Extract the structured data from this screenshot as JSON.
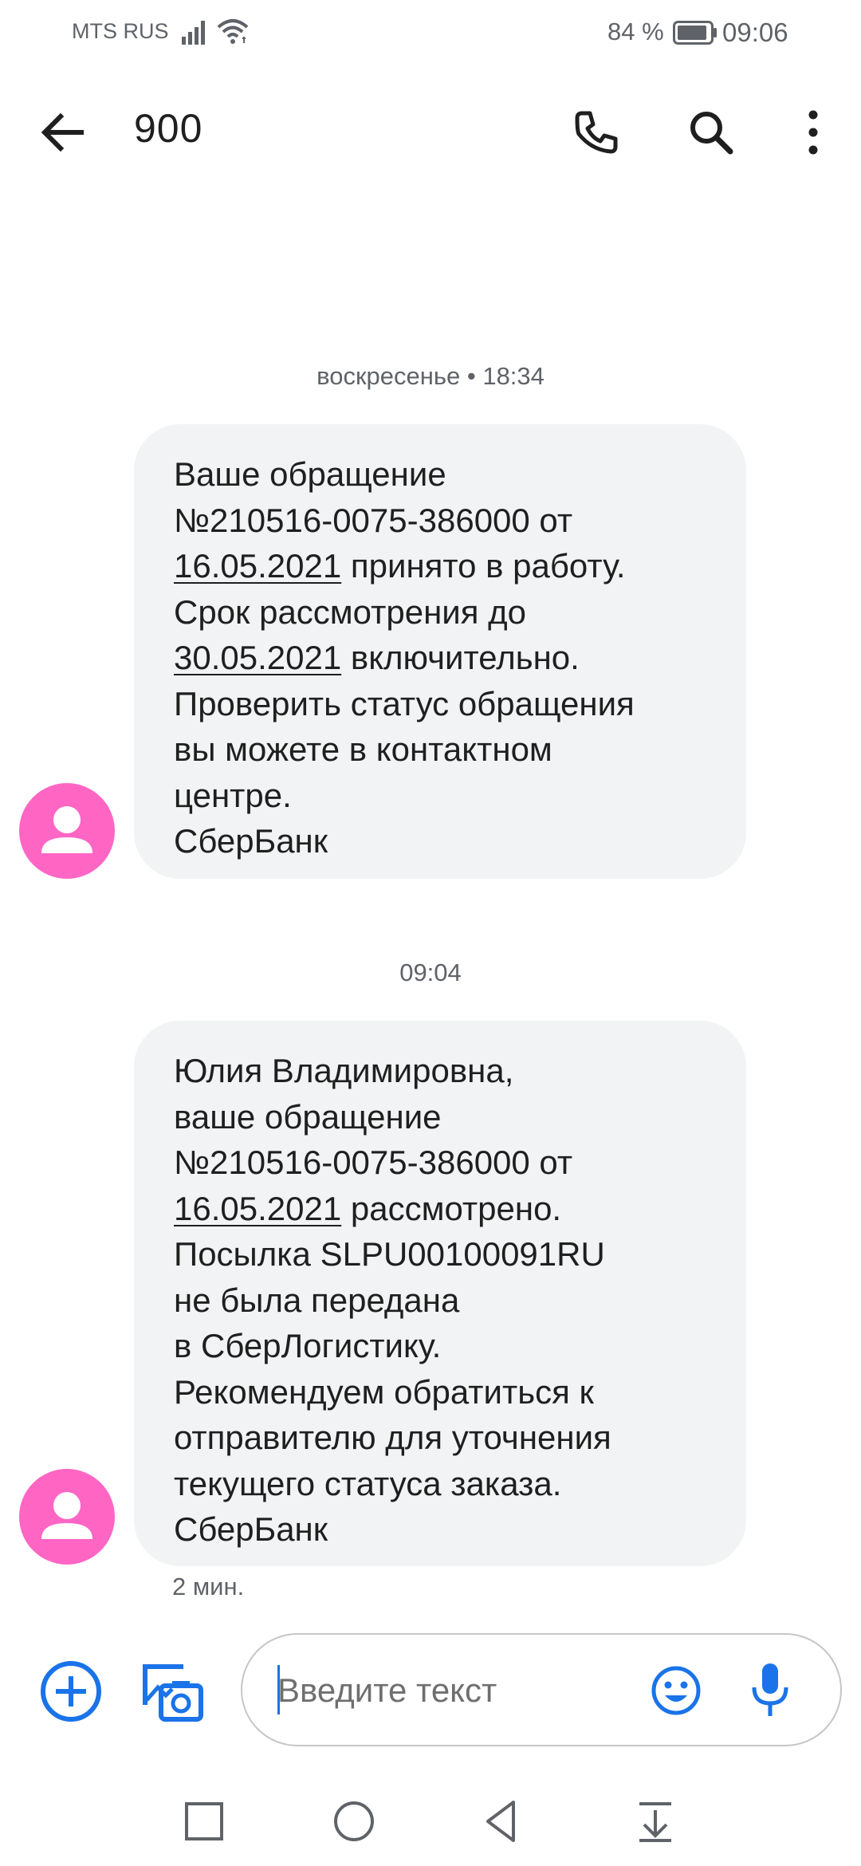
{
  "status_bar": {
    "carrier": "MTS RUS",
    "battery_percent": "84 %",
    "time": "09:06"
  },
  "header": {
    "title": "900",
    "back_icon": "arrow-back-icon",
    "call_icon": "phone-icon",
    "search_icon": "search-icon",
    "menu_icon": "more-vert-icon"
  },
  "messages": [
    {
      "timestamp": "воскресенье • 18:34",
      "lines": {
        "l1": "Ваше обращение",
        "l2": "№210516-0075-386000 от",
        "l3_date": "16.05.2021",
        "l3_rest": " принято в работу.",
        "l4": "Срок рассмотрения до",
        "l5_date": "30.05.2021",
        "l5_rest": " включительно.",
        "l6": "Проверить статус обращения",
        "l7": "вы можете в контактном",
        "l8": "центре.",
        "l9": "СберБанк"
      }
    },
    {
      "timestamp": "09:04",
      "lines": {
        "l1": "Юлия Владимировна,",
        "l2": "ваше обращение",
        "l3": "№210516-0075-386000 от",
        "l4_date": "16.05.2021",
        "l4_rest": " рассмотрено.",
        "l5": "Посылка SLPU00100091RU",
        "l6": "не была передана",
        "l7": "в СберЛогистику.",
        "l8": "Рекомендуем обратиться к",
        "l9": "отправителю для уточнения",
        "l10": "текущего статуса заказа.",
        "l11": "СберБанк"
      },
      "meta": "2 мин."
    }
  ],
  "composer": {
    "placeholder": "Введите текст",
    "value": ""
  },
  "colors": {
    "accent": "#1a73e8",
    "avatar": "#ff66c4",
    "bubble": "#f1f3f4"
  }
}
